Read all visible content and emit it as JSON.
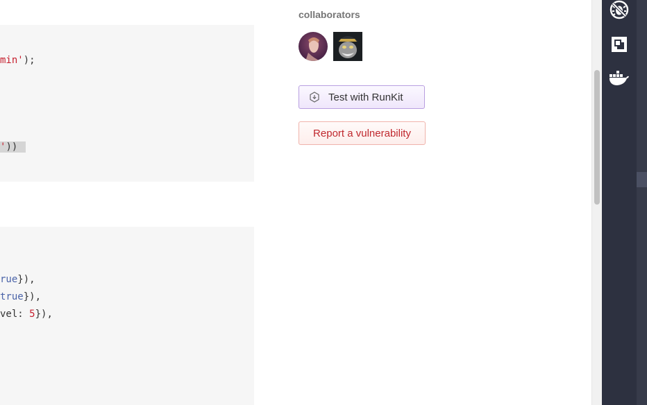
{
  "code_top": {
    "line1": {
      "str": "min'",
      "rest": ");"
    },
    "line2": {
      "str": "'",
      "rest": "))"
    }
  },
  "code_bottom": {
    "line1": {
      "kw": "rue",
      "rest": "}),"
    },
    "line2": {
      "kw": "true",
      "rest": "}),"
    },
    "line3": {
      "pre": "vel: ",
      "num": "5",
      "rest": "}),"
    }
  },
  "sidebar": {
    "collaborators_title": "collaborators",
    "runkit_label": "Test with RunKit",
    "vulnerability_label": "Report a vulnerability"
  },
  "extensions": {
    "icons": [
      "bug-off-icon",
      "frame-icon",
      "docker-icon"
    ]
  },
  "colors": {
    "runkit_border": "#b89ee0",
    "vuln_text": "#c0282e",
    "ext_bar": "#2d3140"
  }
}
